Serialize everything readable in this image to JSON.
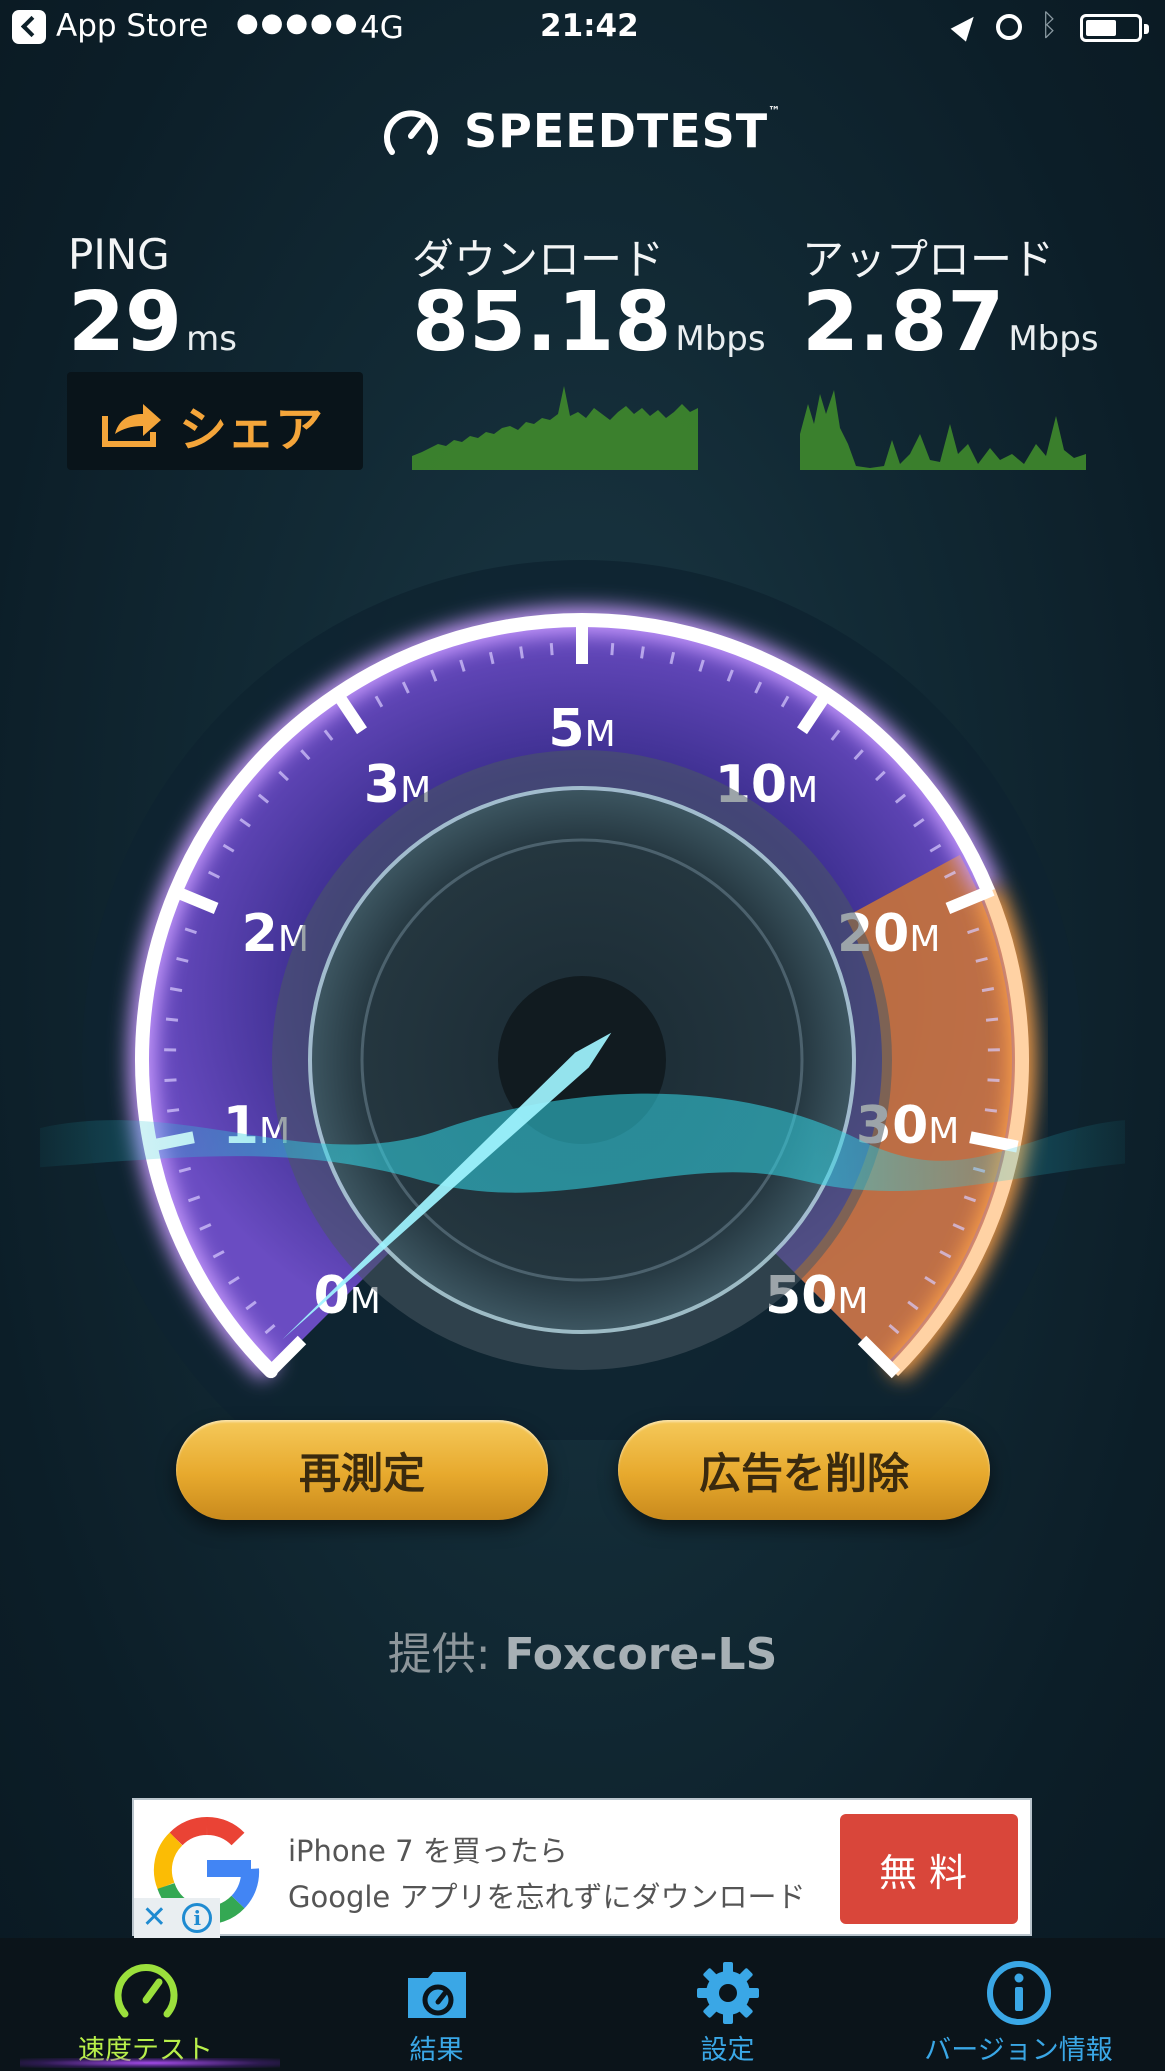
{
  "status_bar": {
    "back_app": "App Store",
    "signal": "●●●●●",
    "network": "4G",
    "time": "21:42"
  },
  "header": {
    "logo_text": "SPEEDTEST",
    "trademark": "™"
  },
  "results": {
    "ping": {
      "label": "PING",
      "value": "29",
      "unit": "ms"
    },
    "download": {
      "label": "ダウンロード",
      "value": "85.18",
      "unit": "Mbps"
    },
    "upload": {
      "label": "アップロード",
      "value": "2.87",
      "unit": "Mbps"
    },
    "share_label": "シェア"
  },
  "gauge": {
    "ticks": [
      {
        "num": "0",
        "unit": "M"
      },
      {
        "num": "1",
        "unit": "M"
      },
      {
        "num": "2",
        "unit": "M"
      },
      {
        "num": "3",
        "unit": "M"
      },
      {
        "num": "5",
        "unit": "M"
      },
      {
        "num": "10",
        "unit": "M"
      },
      {
        "num": "20",
        "unit": "M"
      },
      {
        "num": "30",
        "unit": "M"
      },
      {
        "num": "50",
        "unit": "M"
      }
    ]
  },
  "buttons": {
    "retest": "再測定",
    "remove_ads": "広告を削除"
  },
  "provider": {
    "prefix": "提供: ",
    "name": "Foxcore-LS"
  },
  "ad": {
    "line1": "iPhone 7 を買ったら",
    "line2": "Google アプリを忘れずにダウンロード",
    "cta": "無料"
  },
  "tabs": [
    {
      "label": "速度テスト",
      "icon": "speedometer-icon",
      "active": true
    },
    {
      "label": "結果",
      "icon": "results-folder-icon",
      "active": false
    },
    {
      "label": "設定",
      "icon": "gear-icon",
      "active": false
    },
    {
      "label": "バージョン情報",
      "icon": "info-icon",
      "active": false
    }
  ],
  "colors": {
    "accent_orange": "#f4a53a",
    "gauge_purple": "#5b3fb0",
    "needle_cyan": "#8ff0ff",
    "tab_active": "#b8f04a",
    "tab_inactive": "#3aa7e6",
    "button_gold": "#e7a92d",
    "ad_cta_red": "#d9463a"
  }
}
